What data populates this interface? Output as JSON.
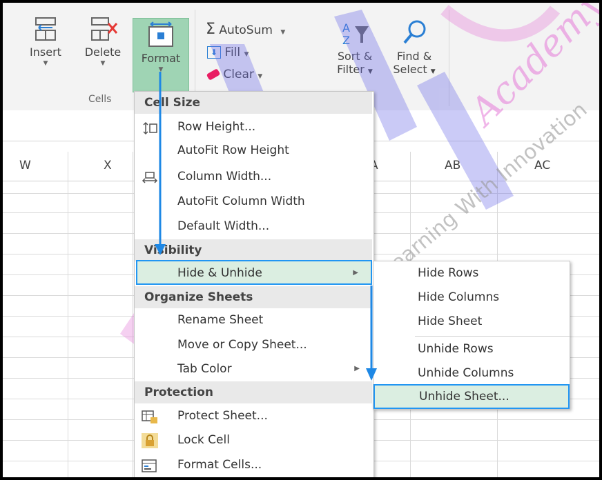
{
  "ribbon": {
    "cells_group": {
      "label": "Cells",
      "insert": "Insert",
      "delete": "Delete",
      "format": "Format"
    },
    "editing": {
      "autosum": "AutoSum",
      "fill": "Fill",
      "clear": "Clear",
      "sort_filter_line1": "Sort &",
      "sort_filter_line2": "Filter",
      "find_select_line1": "Find &",
      "find_select_line2": "Select"
    }
  },
  "columns": [
    "W",
    "X",
    "A",
    "AB",
    "AC"
  ],
  "format_menu": {
    "cell_size": {
      "header": "Cell Size",
      "items": [
        "Row Height...",
        "AutoFit Row Height",
        "Column Width...",
        "AutoFit Column Width",
        "Default Width..."
      ]
    },
    "visibility": {
      "header": "Visibility",
      "items": [
        "Hide & Unhide"
      ]
    },
    "organize": {
      "header": "Organize Sheets",
      "items": [
        "Rename Sheet",
        "Move or Copy Sheet...",
        "Tab Color"
      ]
    },
    "protection": {
      "header": "Protection",
      "items": [
        "Protect Sheet...",
        "Lock Cell",
        "Format Cells..."
      ]
    }
  },
  "submenu": {
    "items": [
      "Hide Rows",
      "Hide Columns",
      "Hide Sheet",
      "Unhide Rows",
      "Unhide Columns",
      "Unhide Sheet..."
    ]
  },
  "watermark": {
    "text1": "Academy",
    "text2": "Learning With Innovation"
  },
  "colors": {
    "highlight_border": "#2196f3",
    "highlight_fill": "#dbeee1",
    "format_button_fill": "#9fd4b4",
    "arrow": "#1e88e5"
  }
}
